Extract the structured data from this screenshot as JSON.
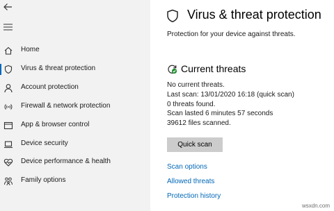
{
  "sidebar": {
    "back_icon": "back-arrow-icon",
    "menu_icon": "hamburger-icon",
    "items": [
      {
        "label": "Home",
        "icon": "home-icon"
      },
      {
        "label": "Virus & threat protection",
        "icon": "shield-icon",
        "selected": true
      },
      {
        "label": "Account protection",
        "icon": "person-icon"
      },
      {
        "label": "Firewall & network protection",
        "icon": "wifi-icon"
      },
      {
        "label": "App & browser control",
        "icon": "window-icon"
      },
      {
        "label": "Device security",
        "icon": "laptop-icon"
      },
      {
        "label": "Device performance & health",
        "icon": "heart-icon"
      },
      {
        "label": "Family options",
        "icon": "family-icon"
      }
    ],
    "accent": "#0067c0"
  },
  "main": {
    "title": "Virus & threat protection",
    "subtitle": "Protection for your device against threats.",
    "current_threats": {
      "heading": "Current threats",
      "lines": [
        "No current threats.",
        "Last scan: 13/01/2020 16:18 (quick scan)",
        "0 threats found.",
        "Scan lasted 6 minutes 57 seconds",
        "39612 files scanned."
      ],
      "button": "Quick scan"
    },
    "links": [
      "Scan options",
      "Allowed threats",
      "Protection history"
    ],
    "link_color": "#0067b8"
  },
  "watermark": "wsxdn.com"
}
